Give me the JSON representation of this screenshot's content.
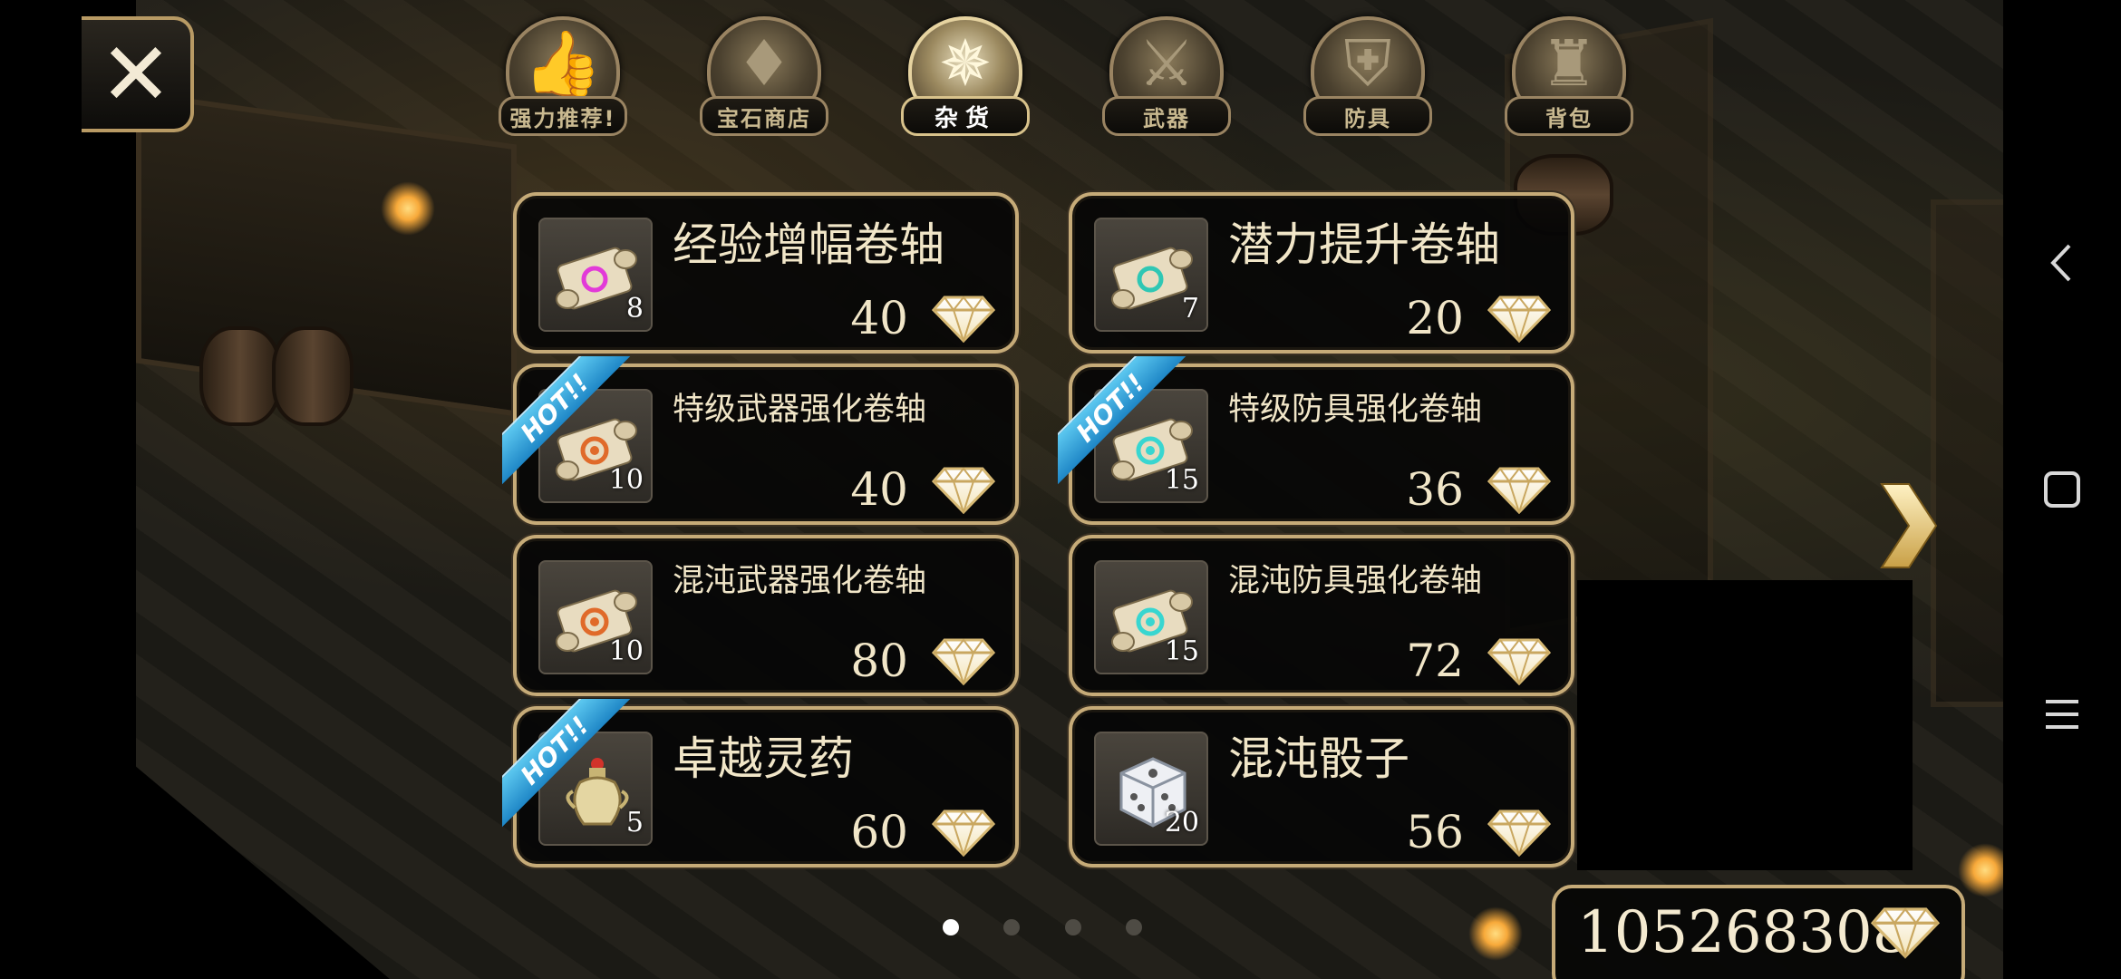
{
  "close_button": {
    "glyph": "✕"
  },
  "tabs": [
    {
      "label": "强力推荐!",
      "icon": "thumbs-up-icon",
      "glyph": "👍",
      "active": false
    },
    {
      "label": "宝石商店",
      "icon": "gem-icon",
      "glyph": "♦",
      "active": false
    },
    {
      "label": "杂货",
      "icon": "compass-icon",
      "glyph": "✵",
      "active": true
    },
    {
      "label": "武器",
      "icon": "sword-icon",
      "glyph": "⚔",
      "active": false
    },
    {
      "label": "防具",
      "icon": "shield-icon",
      "glyph": "⛨",
      "active": false
    },
    {
      "label": "背包",
      "icon": "bag-icon",
      "glyph": "♜",
      "active": false
    }
  ],
  "items": [
    {
      "name": "经验增幅卷轴",
      "qty": "8",
      "price": "40",
      "hot": false,
      "icon": "pink-scroll-icon"
    },
    {
      "name": "潜力提升卷轴",
      "qty": "7",
      "price": "20",
      "hot": false,
      "icon": "teal-scroll-icon"
    },
    {
      "name": "特级武器强化卷轴",
      "qty": "10",
      "price": "40",
      "hot": true,
      "icon": "orange-scroll-icon"
    },
    {
      "name": "特级防具强化卷轴",
      "qty": "15",
      "price": "36",
      "hot": true,
      "icon": "cyan-scroll-icon"
    },
    {
      "name": "混沌武器强化卷轴",
      "qty": "10",
      "price": "80",
      "hot": false,
      "icon": "orange-scroll-icon"
    },
    {
      "name": "混沌防具强化卷轴",
      "qty": "15",
      "price": "72",
      "hot": false,
      "icon": "cyan-scroll-icon"
    },
    {
      "name": "卓越灵药",
      "qty": "5",
      "price": "60",
      "hot": true,
      "icon": "elixir-vase-icon"
    },
    {
      "name": "混沌骰子",
      "qty": "20",
      "price": "56",
      "hot": false,
      "icon": "dice-icon"
    }
  ],
  "hot_badge": "HOT!!",
  "pager": {
    "pages": 4,
    "current": 1
  },
  "balance": {
    "amount": "105268308",
    "currency_icon": "diamond-icon"
  },
  "android_nav": {
    "back": "‹",
    "home": "□",
    "menu": "☰"
  },
  "colors": {
    "frame_gold": "#c6ab78",
    "hot_blue": "#1e86c6",
    "text_cream": "#f1e6c8"
  }
}
